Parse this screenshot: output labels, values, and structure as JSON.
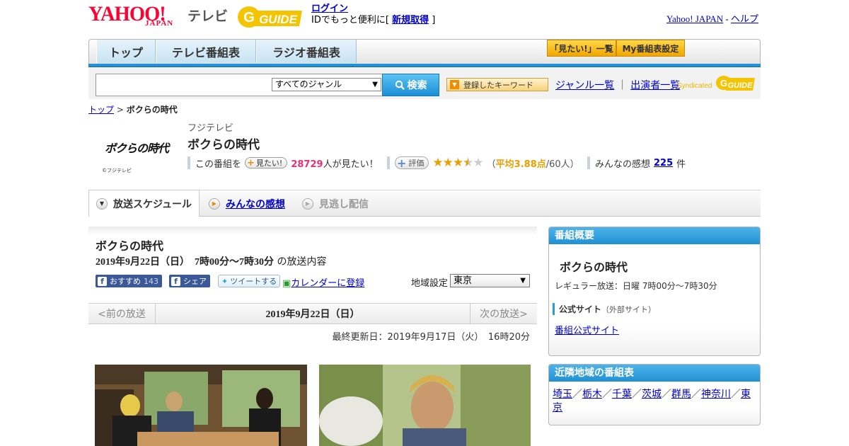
{
  "header": {
    "yahoo_text": "YAHOO!",
    "japan_text": "JAPAN",
    "tv_label": "テレビ",
    "gguide_text": "GUIDE",
    "login_link": "ログイン",
    "login_prefix": "IDでもっと便利に[ ",
    "register_link": "新規取得",
    "login_suffix": " ]",
    "yahoo_japan_link": "Yahoo! JAPAN",
    "separator": " - ",
    "help_link": "ヘルプ"
  },
  "nav": {
    "tabs": [
      "トップ",
      "テレビ番組表",
      "ラジオ番組表"
    ],
    "mitai_list": "「見たい!」一覧",
    "my_settings": "My番組表設定"
  },
  "search": {
    "genre_selected": "すべてのジャンル",
    "search_button": "検索",
    "keyword_button": "登録したキーワード",
    "genre_list_link": "ジャンル一覧",
    "divider": "｜",
    "performer_list_link": "出演者一覧",
    "syndicated_label": "Syndicated"
  },
  "breadcrumb": {
    "top": "トップ",
    "sep": " > ",
    "current": "ボクらの時代"
  },
  "program": {
    "logo_text": "ボクらの時代",
    "logo_copyright": "©フジテレビ",
    "station": "フジテレビ",
    "title": "ボクらの時代",
    "mitai_prefix": "この番組を",
    "mitai_button": "見たい!",
    "mitai_count": "28729",
    "mitai_suffix": "人が見たい！",
    "hyoka_button": "評価",
    "rating_value": 3.88,
    "rating_open": "（",
    "rating_avg": "平均3.88点",
    "rating_count": "/60人）",
    "kansou_label": "みんなの感想",
    "kansou_count": "225",
    "kansou_suffix": "件"
  },
  "program_tabs": [
    "放送スケジュール",
    "みんなの感想",
    "見逃し配信"
  ],
  "main": {
    "title": "ボクらの時代",
    "date_time": "2019年9月22日（日）　7時00分～7時30分",
    "date_suffix": "の放送内容",
    "fb_recommend": "おすすめ",
    "fb_count": "143",
    "fb_share": "シェア",
    "tweet": "ツイートする",
    "calendar_link": "カレンダーに登録",
    "region_label": "地域設定",
    "region_selected": "東京",
    "prev": "<前の放送",
    "current_date": "2019年9月22日（日）",
    "next": "次の放送>",
    "last_updated": "最終更新日：2019年9月17日（火）　16時20分"
  },
  "side": {
    "overview_header": "番組概要",
    "overview_title": "ボクらの時代",
    "regular": "レギュラー放送：日曜 7時00分～7時30分",
    "official_label": "公式サイト",
    "official_note": "（外部サイト）",
    "official_link": "番組公式サイト",
    "nearby_header": "近隣地域の番組表",
    "regions": [
      "埼玉",
      "栃木",
      "千葉",
      "茨城",
      "群馬",
      "神奈川",
      "東京"
    ],
    "region_sep": "／"
  },
  "colors": {
    "yahoo_red": "#ff0033",
    "link_blue": "#0000cc",
    "nav_blue": "#2291d9",
    "star_gold": "#e8a000",
    "count_pink": "#e4317a"
  }
}
